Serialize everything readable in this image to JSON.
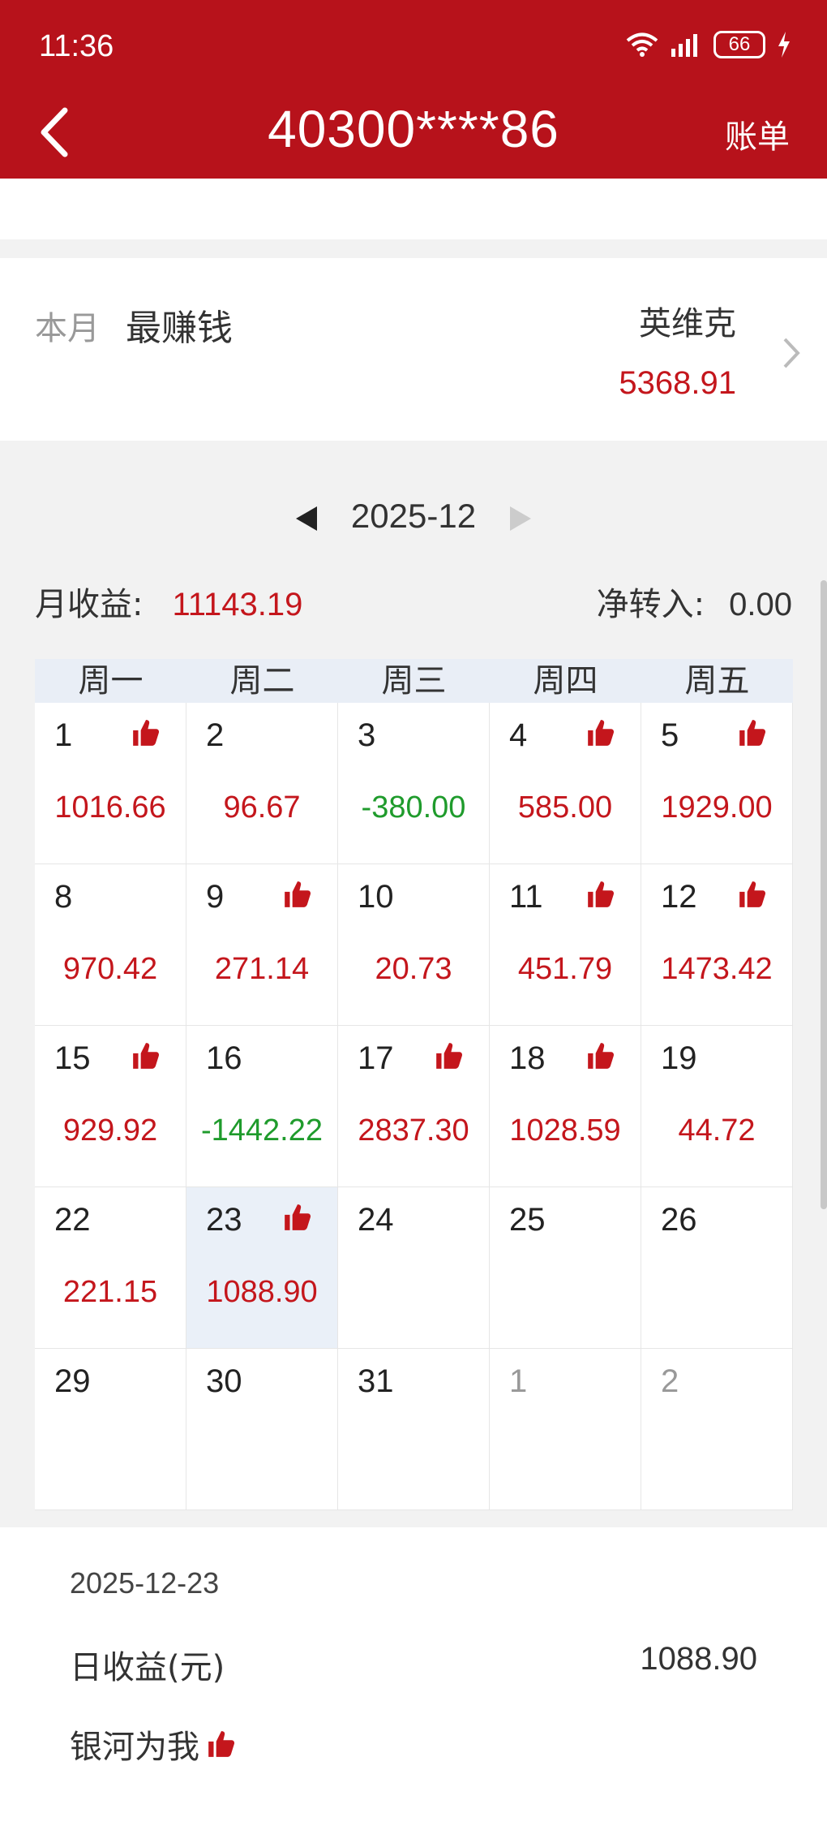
{
  "status": {
    "time": "11:36",
    "battery": "66"
  },
  "header": {
    "title": "40300****86",
    "bill_label": "账单"
  },
  "best": {
    "prefix": "本月",
    "label": "最赚钱",
    "name": "英维克",
    "amount": "5368.91"
  },
  "month": {
    "label": "2025-12"
  },
  "summary": {
    "income_label": "月收益:",
    "income_value": "11143.19",
    "transfer_label": "净转入:",
    "transfer_value": "0.00"
  },
  "calendar": {
    "weekdays": [
      "周一",
      "周二",
      "周三",
      "周四",
      "周五"
    ],
    "cells": [
      {
        "day": "1",
        "value": "1016.66",
        "sign": "pos",
        "thumb": true
      },
      {
        "day": "2",
        "value": "96.67",
        "sign": "pos",
        "thumb": false
      },
      {
        "day": "3",
        "value": "-380.00",
        "sign": "neg",
        "thumb": false
      },
      {
        "day": "4",
        "value": "585.00",
        "sign": "pos",
        "thumb": true
      },
      {
        "day": "5",
        "value": "1929.00",
        "sign": "pos",
        "thumb": true
      },
      {
        "day": "8",
        "value": "970.42",
        "sign": "pos",
        "thumb": false
      },
      {
        "day": "9",
        "value": "271.14",
        "sign": "pos",
        "thumb": true
      },
      {
        "day": "10",
        "value": "20.73",
        "sign": "pos",
        "thumb": false
      },
      {
        "day": "11",
        "value": "451.79",
        "sign": "pos",
        "thumb": true
      },
      {
        "day": "12",
        "value": "1473.42",
        "sign": "pos",
        "thumb": true
      },
      {
        "day": "15",
        "value": "929.92",
        "sign": "pos",
        "thumb": true
      },
      {
        "day": "16",
        "value": "-1442.22",
        "sign": "neg",
        "thumb": false
      },
      {
        "day": "17",
        "value": "2837.30",
        "sign": "pos",
        "thumb": true
      },
      {
        "day": "18",
        "value": "1028.59",
        "sign": "pos",
        "thumb": true
      },
      {
        "day": "19",
        "value": "44.72",
        "sign": "pos",
        "thumb": false
      },
      {
        "day": "22",
        "value": "221.15",
        "sign": "pos",
        "thumb": false
      },
      {
        "day": "23",
        "value": "1088.90",
        "sign": "pos",
        "thumb": true,
        "selected": true
      },
      {
        "day": "24",
        "value": "",
        "sign": "pos",
        "thumb": false
      },
      {
        "day": "25",
        "value": "",
        "sign": "pos",
        "thumb": false
      },
      {
        "day": "26",
        "value": "",
        "sign": "pos",
        "thumb": false
      },
      {
        "day": "29",
        "value": "",
        "sign": "pos",
        "thumb": false
      },
      {
        "day": "30",
        "value": "",
        "sign": "pos",
        "thumb": false
      },
      {
        "day": "31",
        "value": "",
        "sign": "pos",
        "thumb": false
      },
      {
        "day": "1",
        "value": "",
        "sign": "pos",
        "thumb": false,
        "other_month": true
      },
      {
        "day": "2",
        "value": "",
        "sign": "pos",
        "thumb": false,
        "other_month": true
      }
    ]
  },
  "detail": {
    "date": "2025-12-23",
    "label": "日收益(元)",
    "value": "1088.90",
    "tag": "银河为我"
  },
  "colors": {
    "brand": "#b7121b",
    "positive": "#c4161c",
    "negative": "#1f9b2c"
  }
}
